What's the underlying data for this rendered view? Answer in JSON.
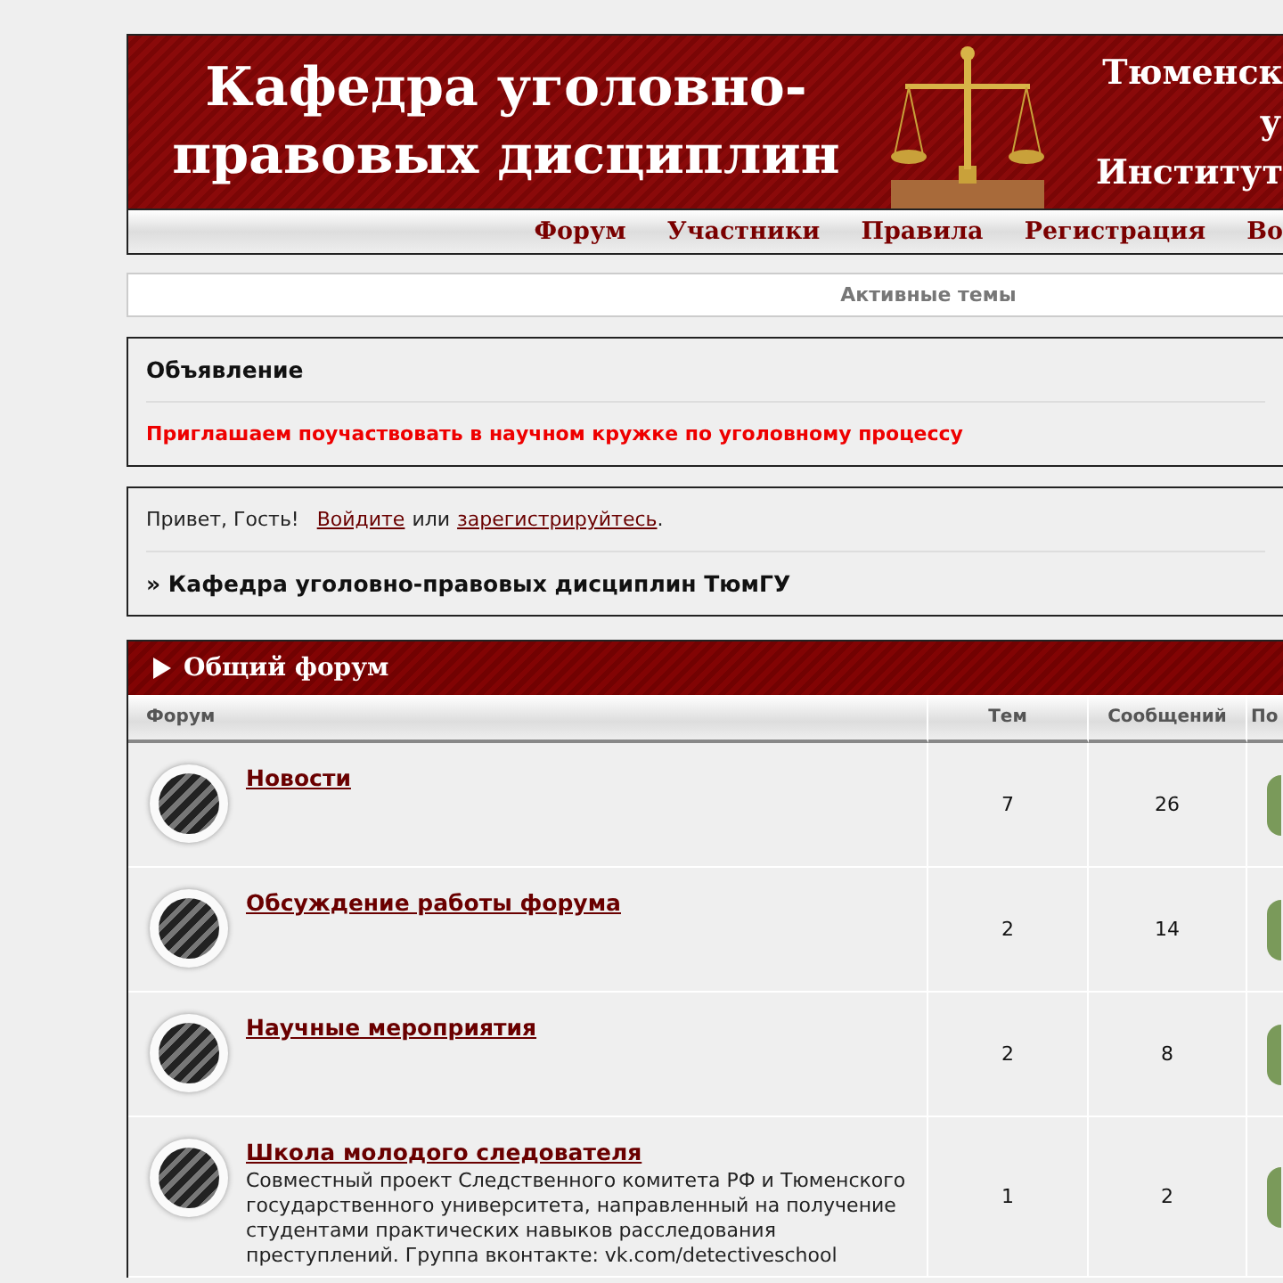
{
  "header": {
    "title_lines": [
      "Кафедра уголовно-",
      "правовых дисциплин"
    ],
    "right_lines": [
      "Тюменск",
      "у",
      "Институт"
    ]
  },
  "nav": [
    {
      "label": "Форум"
    },
    {
      "label": "Участники"
    },
    {
      "label": "Правила"
    },
    {
      "label": "Регистрация"
    },
    {
      "label": "Во"
    }
  ],
  "active_topics": "Активные темы",
  "announcement": {
    "title": "Объявление",
    "text": "Приглашаем поучаствовать в научном кружке по уголовному процессу"
  },
  "greeting": {
    "text": "Привет, Гость!",
    "login_link": "Войдите",
    "between": "или",
    "register_link": "зарегистрируйтесь",
    "end": "."
  },
  "breadcrumb": "» Кафедра уголовно-правовых дисциплин ТюмГУ",
  "category": {
    "title": "Общий форум"
  },
  "columns": [
    "Форум",
    "Тем",
    "Сообщений",
    "По"
  ],
  "forums": [
    {
      "title": "Новости",
      "topics": "7",
      "posts": "26"
    },
    {
      "title": "Обсуждение работы форума",
      "topics": "2",
      "posts": "14"
    },
    {
      "title": "Научные мероприятия",
      "topics": "2",
      "posts": "8"
    },
    {
      "title": "Школа молодого следователя",
      "description": "Совместный проект Следственного комитета РФ и Тюменского государственного университета, направленный на получение студентами практических навыков расследования преступлений. Группа вконтакте: vk.com/detectiveschool",
      "topics": "1",
      "posts": "2"
    }
  ]
}
